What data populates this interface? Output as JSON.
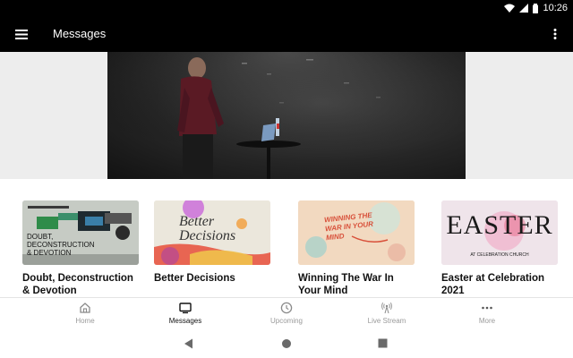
{
  "status": {
    "time": "10:26",
    "icons": [
      "wifi-icon",
      "signal-icon",
      "battery-icon"
    ]
  },
  "app_bar": {
    "title": "Messages",
    "menu_icon": "menu-icon",
    "overflow_icon": "more-vertical-icon"
  },
  "series": [
    {
      "title": "Doubt, Deconstruction & Devotion",
      "art_text": "DOUBT, DECONSTRUCTION & DEVOTION"
    },
    {
      "title": "Better Decisions",
      "art_text": "Better Decisions"
    },
    {
      "title": "Winning The War In Your Mind",
      "art_text": "WINNING THE WAR IN YOUR MIND"
    },
    {
      "title": "Easter at Celebration 2021",
      "art_text": "EASTER",
      "art_subtext": "AT CELEBRATION CHURCH"
    }
  ],
  "bottom_nav": {
    "items": [
      {
        "label": "Home",
        "icon": "home-icon",
        "active": false
      },
      {
        "label": "Messages",
        "icon": "tv-icon",
        "active": true
      },
      {
        "label": "Upcoming",
        "icon": "clock-icon",
        "active": false
      },
      {
        "label": "Live Stream",
        "icon": "broadcast-icon",
        "active": false
      },
      {
        "label": "More",
        "icon": "more-horizontal-icon",
        "active": false
      }
    ]
  },
  "system_nav": [
    "back-icon",
    "home-circle-icon",
    "recents-icon"
  ],
  "colors": {
    "app_bar": "#000000",
    "hero_bg": "#ededed",
    "active_nav": "#111111",
    "inactive_nav": "#9a9a9a"
  }
}
